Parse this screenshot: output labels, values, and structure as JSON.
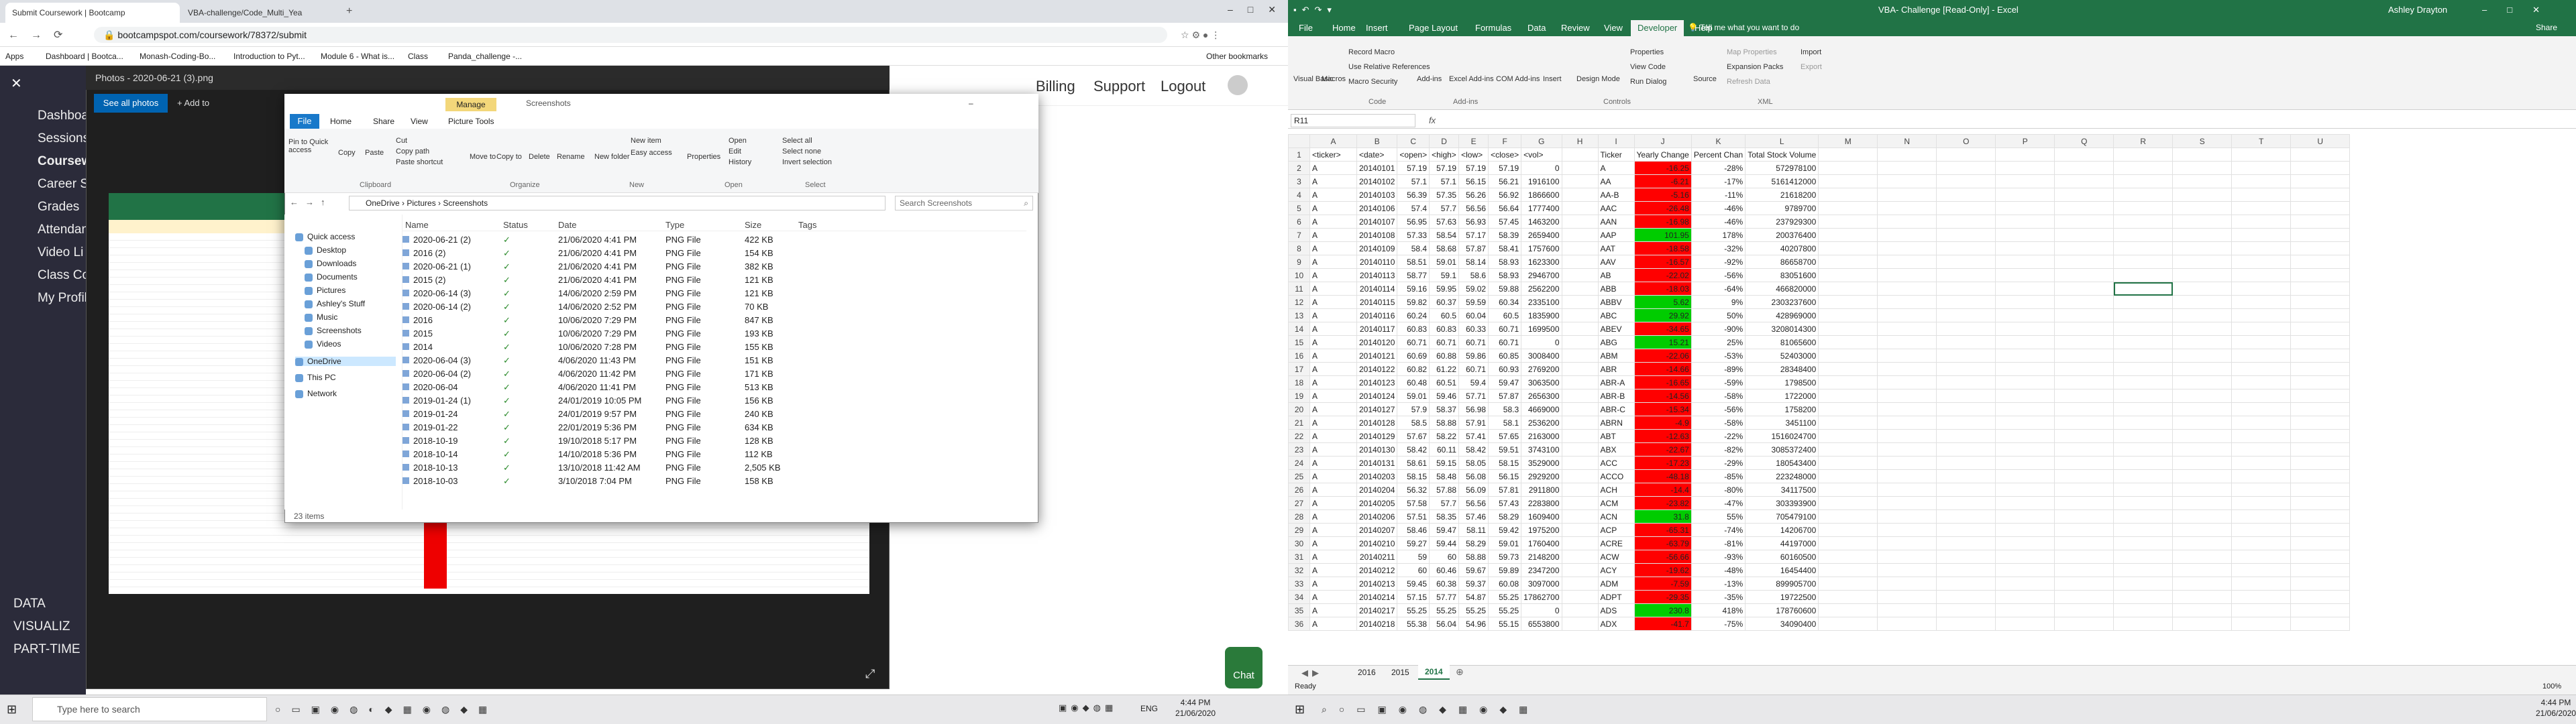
{
  "chrome": {
    "tabs": [
      {
        "label": "Submit Coursework | Bootcamp",
        "active": true
      },
      {
        "label": "VBA-challenge/Code_Multi_Yea",
        "active": false
      }
    ],
    "url": "bootcampspot.com/coursework/78372/submit",
    "bookmarks": [
      "Apps",
      "Dashboard | Bootca...",
      "Monash-Coding-Bo...",
      "Introduction to Pyt...",
      "Module 6 - What is...",
      "Class",
      "Panda_challenge -...",
      "Other bookmarks"
    ]
  },
  "site": {
    "nav_items": [
      "Dashboard",
      "Sessions",
      "Coursework",
      "Career S",
      "Grades",
      "Attendance",
      "Video Li",
      "Class Co",
      "My Profil"
    ],
    "nav_bottom": [
      "DATA",
      "VISUALIZ",
      "PART-TIME"
    ],
    "top_links": [
      "Billing",
      "Support",
      "Logout"
    ],
    "chat_label": "Chat"
  },
  "photos": {
    "title": "Photos - 2020-06-21 (3).png",
    "see_all": "See all photos",
    "add_to": "+ Add to"
  },
  "explorer": {
    "manage_tab": "Manage",
    "title": "Screenshots",
    "tabs": [
      "File",
      "Home",
      "Share",
      "View",
      "Picture Tools"
    ],
    "ribbon_groups": [
      "Clipboard",
      "Organize",
      "New",
      "Open",
      "Select"
    ],
    "ribbon_buttons": [
      "Pin to Quick access",
      "Copy",
      "Paste",
      "Cut",
      "Copy path",
      "Paste shortcut",
      "Move to",
      "Copy to",
      "Delete",
      "Rename",
      "New folder",
      "New item",
      "Easy access",
      "Properties",
      "Open",
      "Edit",
      "History",
      "Select all",
      "Select none",
      "Invert selection"
    ],
    "path": [
      "OneDrive",
      "Pictures",
      "Screenshots"
    ],
    "search_placeholder": "Search Screenshots",
    "nav": [
      {
        "label": "Quick access",
        "icon": "star-icon"
      },
      {
        "label": "Desktop",
        "icon": "desktop-icon"
      },
      {
        "label": "Downloads",
        "icon": "download-icon"
      },
      {
        "label": "Documents",
        "icon": "document-icon"
      },
      {
        "label": "Pictures",
        "icon": "picture-icon"
      },
      {
        "label": "Ashley's Stuff",
        "icon": "folder-icon"
      },
      {
        "label": "Music",
        "icon": "music-icon"
      },
      {
        "label": "Screenshots",
        "icon": "folder-icon"
      },
      {
        "label": "Videos",
        "icon": "video-icon"
      },
      {
        "label": "OneDrive",
        "icon": "cloud-icon"
      },
      {
        "label": "This PC",
        "icon": "computer-icon"
      },
      {
        "label": "Network",
        "icon": "network-icon"
      }
    ],
    "columns": [
      "Name",
      "Status",
      "Date",
      "Type",
      "Size",
      "Tags"
    ],
    "files": [
      [
        "2020-06-21 (2)",
        "21/06/2020 4:41 PM",
        "PNG File",
        "422 KB"
      ],
      [
        "2016 (2)",
        "21/06/2020 4:41 PM",
        "PNG File",
        "154 KB"
      ],
      [
        "2020-06-21 (1)",
        "21/06/2020 4:41 PM",
        "PNG File",
        "382 KB"
      ],
      [
        "2015 (2)",
        "21/06/2020 4:41 PM",
        "PNG File",
        "121 KB"
      ],
      [
        "2020-06-14 (3)",
        "14/06/2020 2:59 PM",
        "PNG File",
        "121 KB"
      ],
      [
        "2020-06-14 (2)",
        "14/06/2020 2:52 PM",
        "PNG File",
        "70 KB"
      ],
      [
        "2016",
        "10/06/2020 7:29 PM",
        "PNG File",
        "847 KB"
      ],
      [
        "2015",
        "10/06/2020 7:29 PM",
        "PNG File",
        "193 KB"
      ],
      [
        "2014",
        "10/06/2020 7:28 PM",
        "PNG File",
        "155 KB"
      ],
      [
        "2020-06-04 (3)",
        "4/06/2020 11:43 PM",
        "PNG File",
        "151 KB"
      ],
      [
        "2020-06-04 (2)",
        "4/06/2020 11:42 PM",
        "PNG File",
        "171 KB"
      ],
      [
        "2020-06-04",
        "4/06/2020 11:41 PM",
        "PNG File",
        "513 KB"
      ],
      [
        "2019-01-24 (1)",
        "24/01/2019 10:05 PM",
        "PNG File",
        "156 KB"
      ],
      [
        "2019-01-24",
        "24/01/2019 9:57 PM",
        "PNG File",
        "240 KB"
      ],
      [
        "2019-01-22",
        "22/01/2019 5:36 PM",
        "PNG File",
        "634 KB"
      ],
      [
        "2018-10-19",
        "19/10/2018 5:17 PM",
        "PNG File",
        "128 KB"
      ],
      [
        "2018-10-14",
        "14/10/2018 5:36 PM",
        "PNG File",
        "112 KB"
      ],
      [
        "2018-10-13",
        "13/10/2018 11:42 AM",
        "PNG File",
        "2,505 KB"
      ],
      [
        "2018-10-03",
        "3/10/2018 7:04 PM",
        "PNG File",
        "158 KB"
      ]
    ],
    "status": "23 items"
  },
  "excel": {
    "title": "VBA- Challenge [Read-Only] - Excel",
    "user": "Ashley Drayton",
    "tabs": [
      "File",
      "Home",
      "Insert",
      "Page Layout",
      "Formulas",
      "Data",
      "Review",
      "View",
      "Developer",
      "Help"
    ],
    "active_tab": "Developer",
    "tell_me": "Tell me what you want to do",
    "share": "Share",
    "ribbon": {
      "code": [
        "Visual Basic",
        "Macros",
        "Record Macro",
        "Use Relative References",
        "Macro Security"
      ],
      "addins": [
        "Add-ins",
        "Excel Add-ins",
        "COM Add-ins"
      ],
      "controls": [
        "Insert",
        "Design Mode",
        "Properties",
        "View Code",
        "Run Dialog"
      ],
      "xml": [
        "Source",
        "Map Properties",
        "Expansion Packs",
        "Refresh Data",
        "Import",
        "Export"
      ],
      "groups": [
        "Code",
        "Add-ins",
        "Controls",
        "XML"
      ]
    },
    "name_box": "R11",
    "columns": [
      "A",
      "B",
      "C",
      "D",
      "E",
      "F",
      "G",
      "H",
      "I",
      "J",
      "K",
      "L",
      "M",
      "N",
      "O",
      "P",
      "Q",
      "R",
      "S",
      "T",
      "U"
    ],
    "headers": [
      "<ticker>",
      "<date>",
      "<open>",
      "<high>",
      "<low>",
      "<close>",
      "<vol>",
      "",
      "Ticker",
      "Yearly Change",
      "Percent Chan",
      "Total Stock Volume"
    ],
    "rows": [
      [
        "A",
        "20140101",
        "57.19",
        "57.19",
        "57.19",
        "57.19",
        "0",
        "",
        "A",
        "-16.25",
        "-28%",
        "572978100"
      ],
      [
        "A",
        "20140102",
        "57.1",
        "57.1",
        "56.15",
        "56.21",
        "1916100",
        "",
        "AA",
        "-6.21",
        "-17%",
        "5161412000"
      ],
      [
        "A",
        "20140103",
        "56.39",
        "57.35",
        "56.26",
        "56.92",
        "1866600",
        "",
        "AA-B",
        "-5.16",
        "-11%",
        "21618200"
      ],
      [
        "A",
        "20140106",
        "57.4",
        "57.7",
        "56.56",
        "56.64",
        "1777400",
        "",
        "AAC",
        "-26.48",
        "-46%",
        "9789700"
      ],
      [
        "A",
        "20140107",
        "56.95",
        "57.63",
        "56.93",
        "57.45",
        "1463200",
        "",
        "AAN",
        "-16.98",
        "-46%",
        "237929300"
      ],
      [
        "A",
        "20140108",
        "57.33",
        "58.54",
        "57.17",
        "58.39",
        "2659400",
        "",
        "AAP",
        "101.95",
        "178%",
        "200376400"
      ],
      [
        "A",
        "20140109",
        "58.4",
        "58.68",
        "57.87",
        "58.41",
        "1757600",
        "",
        "AAT",
        "-18.58",
        "-32%",
        "40207800"
      ],
      [
        "A",
        "20140110",
        "58.51",
        "59.01",
        "58.14",
        "58.93",
        "1623300",
        "",
        "AAV",
        "-16.57",
        "-92%",
        "86658700"
      ],
      [
        "A",
        "20140113",
        "58.77",
        "59.1",
        "58.6",
        "58.93",
        "2946700",
        "",
        "AB",
        "-22.02",
        "-56%",
        "83051600"
      ],
      [
        "A",
        "20140114",
        "59.16",
        "59.95",
        "59.02",
        "59.88",
        "2562200",
        "",
        "ABB",
        "-18.03",
        "-64%",
        "466820000"
      ],
      [
        "A",
        "20140115",
        "59.82",
        "60.37",
        "59.59",
        "60.34",
        "2335100",
        "",
        "ABBV",
        "5.62",
        "9%",
        "2303237600"
      ],
      [
        "A",
        "20140116",
        "60.24",
        "60.5",
        "60.04",
        "60.5",
        "1835900",
        "",
        "ABC",
        "29.92",
        "50%",
        "428969000"
      ],
      [
        "A",
        "20140117",
        "60.83",
        "60.83",
        "60.33",
        "60.71",
        "1699500",
        "",
        "ABEV",
        "-34.65",
        "-90%",
        "3208014300"
      ],
      [
        "A",
        "20140120",
        "60.71",
        "60.71",
        "60.71",
        "60.71",
        "0",
        "",
        "ABG",
        "15.21",
        "25%",
        "81065600"
      ],
      [
        "A",
        "20140121",
        "60.69",
        "60.88",
        "59.86",
        "60.85",
        "3008400",
        "",
        "ABM",
        "-22.06",
        "-53%",
        "52403000"
      ],
      [
        "A",
        "20140122",
        "60.82",
        "61.22",
        "60.71",
        "60.93",
        "2769200",
        "",
        "ABR",
        "-14.66",
        "-89%",
        "28348400"
      ],
      [
        "A",
        "20140123",
        "60.48",
        "60.51",
        "59.4",
        "59.47",
        "3063500",
        "",
        "ABR-A",
        "-16.65",
        "-59%",
        "1798500"
      ],
      [
        "A",
        "20140124",
        "59.01",
        "59.46",
        "57.71",
        "57.87",
        "2656300",
        "",
        "ABR-B",
        "-14.56",
        "-58%",
        "1722000"
      ],
      [
        "A",
        "20140127",
        "57.9",
        "58.37",
        "56.98",
        "58.3",
        "4669000",
        "",
        "ABR-C",
        "-15.34",
        "-56%",
        "1758200"
      ],
      [
        "A",
        "20140128",
        "58.5",
        "58.88",
        "57.91",
        "58.1",
        "2536200",
        "",
        "ABRN",
        "-4.9",
        "-58%",
        "3451100"
      ],
      [
        "A",
        "20140129",
        "57.67",
        "58.22",
        "57.41",
        "57.65",
        "2163000",
        "",
        "ABT",
        "-12.63",
        "-22%",
        "1516024700"
      ],
      [
        "A",
        "20140130",
        "58.42",
        "60.11",
        "58.42",
        "59.51",
        "3743100",
        "",
        "ABX",
        "-22.67",
        "-82%",
        "3085372400"
      ],
      [
        "A",
        "20140131",
        "58.61",
        "59.15",
        "58.05",
        "58.15",
        "3529000",
        "",
        "ACC",
        "-17.23",
        "-29%",
        "180543400"
      ],
      [
        "A",
        "20140203",
        "58.15",
        "58.48",
        "56.08",
        "56.15",
        "2929200",
        "",
        "ACCO",
        "-48.18",
        "-85%",
        "223248000"
      ],
      [
        "A",
        "20140204",
        "56.32",
        "57.88",
        "56.09",
        "57.81",
        "2911800",
        "",
        "ACH",
        "-14.4",
        "-80%",
        "34117500"
      ],
      [
        "A",
        "20140205",
        "57.58",
        "57.7",
        "56.56",
        "57.43",
        "2283800",
        "",
        "ACM",
        "-23.82",
        "-47%",
        "303393900"
      ],
      [
        "A",
        "20140206",
        "57.51",
        "58.35",
        "57.46",
        "58.29",
        "1609400",
        "",
        "ACN",
        "31.8",
        "55%",
        "705479100"
      ],
      [
        "A",
        "20140207",
        "58.46",
        "59.47",
        "58.11",
        "59.42",
        "1975200",
        "",
        "ACP",
        "-65.31",
        "-74%",
        "14206700"
      ],
      [
        "A",
        "20140210",
        "59.27",
        "59.44",
        "58.29",
        "59.01",
        "1760400",
        "",
        "ACRE",
        "-63.79",
        "-81%",
        "44197000"
      ],
      [
        "A",
        "20140211",
        "59",
        "60",
        "58.88",
        "59.73",
        "2148200",
        "",
        "ACW",
        "-56.66",
        "-93%",
        "60160500"
      ],
      [
        "A",
        "20140212",
        "60",
        "60.46",
        "59.67",
        "59.89",
        "2347200",
        "",
        "ACY",
        "-19.62",
        "-48%",
        "16454400"
      ],
      [
        "A",
        "20140213",
        "59.45",
        "60.38",
        "59.37",
        "60.08",
        "3097000",
        "",
        "ADM",
        "-7.59",
        "-13%",
        "899905700"
      ],
      [
        "A",
        "20140214",
        "57.15",
        "57.77",
        "54.87",
        "55.25",
        "17862700",
        "",
        "ADPT",
        "-29.35",
        "-35%",
        "19722500"
      ],
      [
        "A",
        "20140217",
        "55.25",
        "55.25",
        "55.25",
        "55.25",
        "0",
        "",
        "ADS",
        "230.8",
        "418%",
        "178760600"
      ],
      [
        "A",
        "20140218",
        "55.38",
        "56.04",
        "54.96",
        "55.15",
        "6553800",
        "",
        "ADX",
        "-41.7",
        "-75%",
        "34090400"
      ]
    ],
    "sheets": [
      "2016",
      "2015",
      "2014"
    ],
    "active_sheet": "2014",
    "status_left": "Ready",
    "zoom": "100%"
  },
  "taskbar": {
    "search_placeholder": "Type here to search",
    "time": "4:44 PM",
    "date": "21/06/2020",
    "lang": "ENG"
  },
  "colors": {
    "excel_green": "#217346",
    "negative": "#ff0000",
    "positive": "#00cc00",
    "site_nav": "#2b2b3a"
  }
}
